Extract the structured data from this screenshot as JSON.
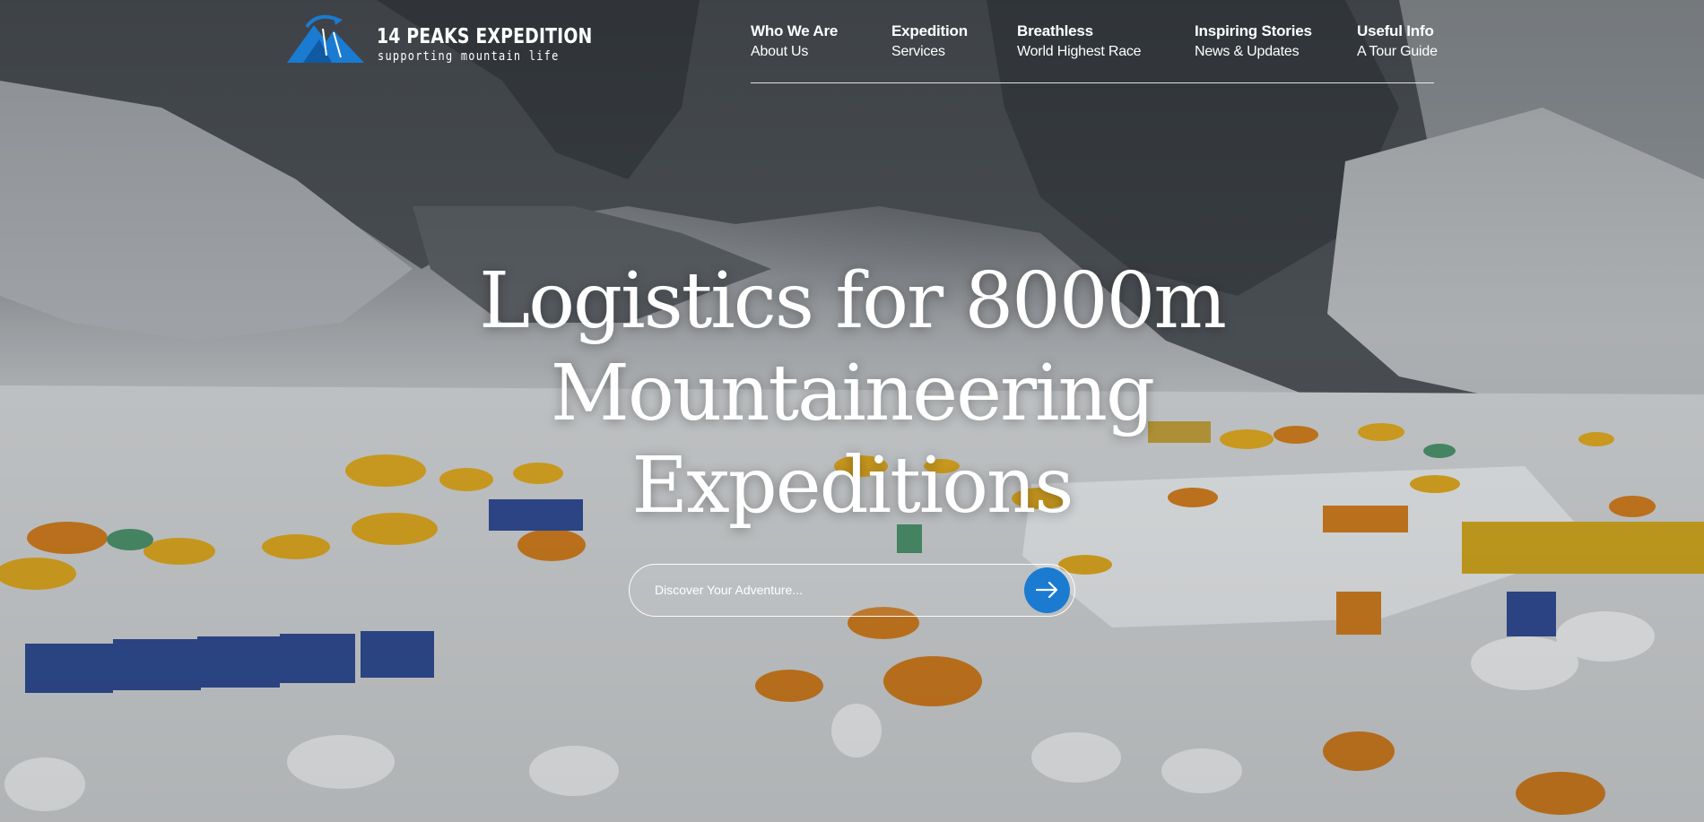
{
  "brand": {
    "name": "14 PEAKS EXPEDITION",
    "tagline": "supporting mountain life",
    "accent_color": "#1a7bd1"
  },
  "nav": {
    "items": [
      {
        "title": "Who We Are",
        "subtitle": "About Us"
      },
      {
        "title": "Expedition",
        "subtitle": "Services"
      },
      {
        "title": "Breathless",
        "subtitle": "World Highest Race"
      },
      {
        "title": "Inspiring Stories",
        "subtitle": "News & Updates"
      },
      {
        "title": "Useful Info",
        "subtitle": "A Tour Guide"
      }
    ]
  },
  "hero": {
    "headline_line1": "Logistics for 8000m",
    "headline_line2": "Mountaineering",
    "headline_line3": "Expeditions"
  },
  "search": {
    "placeholder": "Discover Your Adventure...",
    "button_icon": "arrow-right-icon"
  }
}
